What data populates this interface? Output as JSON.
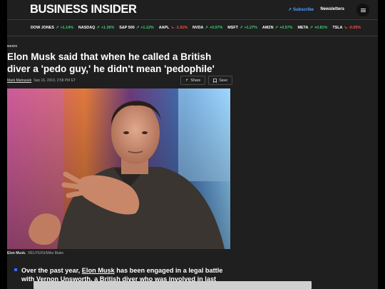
{
  "header": {
    "logo": "BUSINESS INSIDER",
    "subscribe": "Subscribe",
    "newsletters": "Newsletters"
  },
  "ticker": [
    {
      "name": "DOW JONES",
      "change": "+1.14%",
      "dir": "up"
    },
    {
      "name": "NASDAQ",
      "change": "+1.36%",
      "dir": "up"
    },
    {
      "name": "S&P 500",
      "change": "+1.12%",
      "dir": "up"
    },
    {
      "name": "AAPL",
      "change": "-1.91%",
      "dir": "down"
    },
    {
      "name": "NVDA",
      "change": "+0.07%",
      "dir": "up"
    },
    {
      "name": "MSFT",
      "change": "+1.27%",
      "dir": "up"
    },
    {
      "name": "AMZN",
      "change": "+0.57%",
      "dir": "up"
    },
    {
      "name": "META",
      "change": "+0.81%",
      "dir": "up"
    },
    {
      "name": "TSLA",
      "change": "-0.05%",
      "dir": "down"
    }
  ],
  "article": {
    "category": "NEWS",
    "headline": "Elon Musk said that when he called a British diver a 'pedo guy,' he didn't mean 'pedophile'",
    "author": "Mark Matousek",
    "date": "Sep 16, 2019, 2:58 PM ET",
    "share_label": "Share",
    "save_label": "Save",
    "caption_subject": "Elon Musk.",
    "caption_credit": "REUTERS/Mike Blake",
    "body_prefix": "Over the past year, ",
    "body_link": "Elon Musk",
    "body_suffix": " has been engaged in a legal battle with Vernon Unsworth, a British diver who was involved in last"
  },
  "colors": {
    "background": "#1f1f1f",
    "accent": "#4ea1ff",
    "up": "#3fcf72",
    "down": "#ff4d4d",
    "bullet": "#3b6cff"
  }
}
